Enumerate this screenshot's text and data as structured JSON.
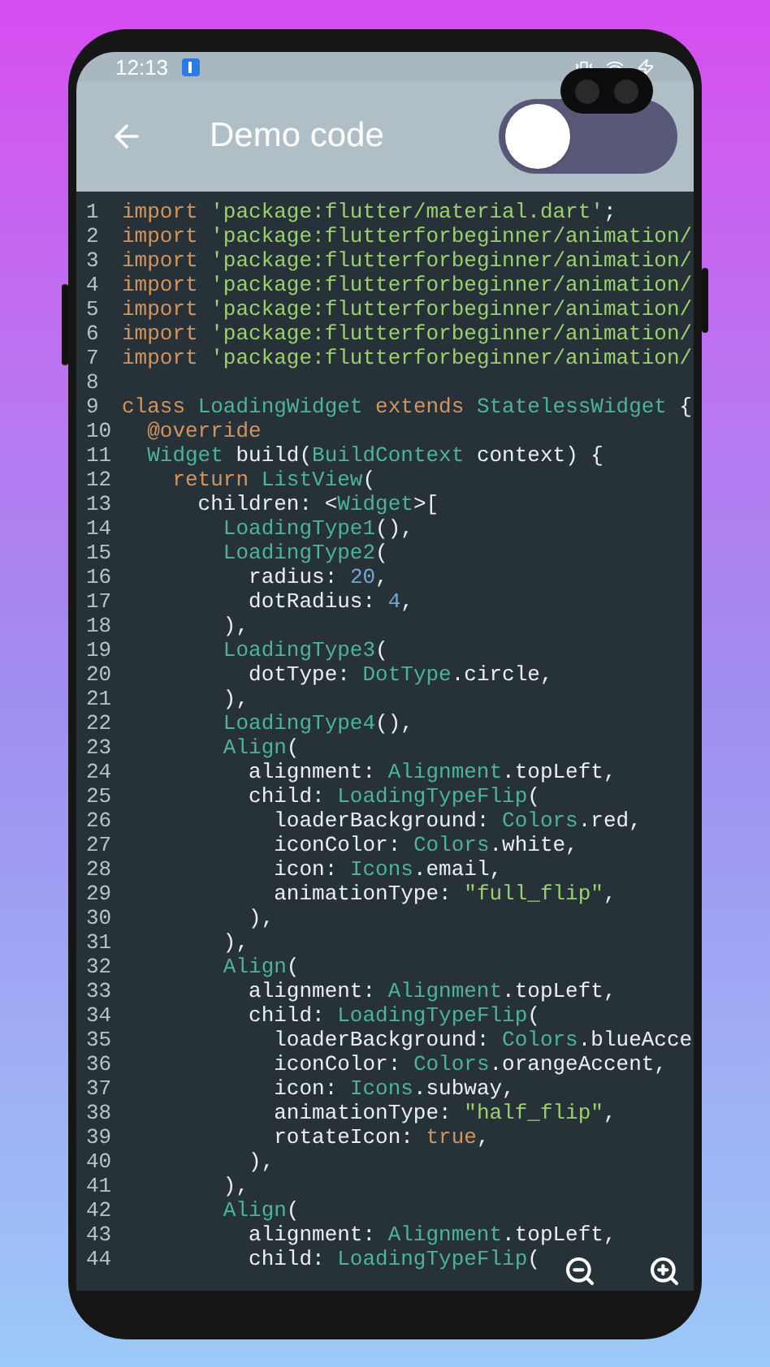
{
  "status_bar": {
    "time": "12:13"
  },
  "app_bar": {
    "title": "Demo code",
    "theme_switch": {
      "on": false
    }
  },
  "code": {
    "lines": [
      {
        "number": "1",
        "tokens": [
          {
            "kind": "keyword",
            "text": "import"
          },
          {
            "kind": "string",
            "text": " 'package:flutter/material.dart'"
          },
          {
            "kind": "plain",
            "text": ";"
          }
        ]
      },
      {
        "number": "2",
        "tokens": [
          {
            "kind": "keyword",
            "text": "import"
          },
          {
            "kind": "string",
            "text": " 'package:flutterforbeginner/animation/"
          }
        ]
      },
      {
        "number": "3",
        "tokens": [
          {
            "kind": "keyword",
            "text": "import"
          },
          {
            "kind": "string",
            "text": " 'package:flutterforbeginner/animation/"
          }
        ]
      },
      {
        "number": "4",
        "tokens": [
          {
            "kind": "keyword",
            "text": "import"
          },
          {
            "kind": "string",
            "text": " 'package:flutterforbeginner/animation/"
          }
        ]
      },
      {
        "number": "5",
        "tokens": [
          {
            "kind": "keyword",
            "text": "import"
          },
          {
            "kind": "string",
            "text": " 'package:flutterforbeginner/animation/"
          }
        ]
      },
      {
        "number": "6",
        "tokens": [
          {
            "kind": "keyword",
            "text": "import"
          },
          {
            "kind": "string",
            "text": " 'package:flutterforbeginner/animation/"
          }
        ]
      },
      {
        "number": "7",
        "tokens": [
          {
            "kind": "keyword",
            "text": "import"
          },
          {
            "kind": "string",
            "text": " 'package:flutterforbeginner/animation/"
          }
        ]
      },
      {
        "number": "8"
      },
      {
        "number": "9",
        "tokens": [
          {
            "kind": "keyword",
            "text": "class"
          },
          {
            "kind": "type",
            "text": " LoadingWidget"
          },
          {
            "kind": "keyword",
            "text": " extends"
          },
          {
            "kind": "type",
            "text": " StatelessWidget"
          },
          {
            "kind": "plain",
            "text": " {"
          }
        ]
      },
      {
        "number": "10",
        "tokens": [
          {
            "kind": "keyword",
            "text": "  @override"
          }
        ]
      },
      {
        "number": "11",
        "tokens": [
          {
            "kind": "type",
            "text": "  Widget"
          },
          {
            "kind": "plain",
            "text": " build("
          },
          {
            "kind": "type",
            "text": "BuildContext"
          },
          {
            "kind": "plain",
            "text": " context) {"
          }
        ]
      },
      {
        "number": "12",
        "tokens": [
          {
            "kind": "keyword",
            "text": "    return"
          },
          {
            "kind": "type",
            "text": " ListView"
          },
          {
            "kind": "plain",
            "text": "("
          }
        ]
      },
      {
        "number": "13",
        "tokens": [
          {
            "kind": "plain",
            "text": "      children: <"
          },
          {
            "kind": "type",
            "text": "Widget"
          },
          {
            "kind": "plain",
            "text": ">["
          }
        ]
      },
      {
        "number": "14",
        "tokens": [
          {
            "kind": "type",
            "text": "        LoadingType1"
          },
          {
            "kind": "plain",
            "text": "(),"
          }
        ]
      },
      {
        "number": "15",
        "tokens": [
          {
            "kind": "type",
            "text": "        LoadingType2"
          },
          {
            "kind": "plain",
            "text": "("
          }
        ]
      },
      {
        "number": "16",
        "tokens": [
          {
            "kind": "plain",
            "text": "          radius: "
          },
          {
            "kind": "number",
            "text": "20"
          },
          {
            "kind": "plain",
            "text": ","
          }
        ]
      },
      {
        "number": "17",
        "tokens": [
          {
            "kind": "plain",
            "text": "          dotRadius: "
          },
          {
            "kind": "number",
            "text": "4"
          },
          {
            "kind": "plain",
            "text": ","
          }
        ]
      },
      {
        "number": "18",
        "tokens": [
          {
            "kind": "plain",
            "text": "        ),"
          }
        ]
      },
      {
        "number": "19",
        "tokens": [
          {
            "kind": "type",
            "text": "        LoadingType3"
          },
          {
            "kind": "plain",
            "text": "("
          }
        ]
      },
      {
        "number": "20",
        "tokens": [
          {
            "kind": "plain",
            "text": "          dotType: "
          },
          {
            "kind": "type",
            "text": "DotType"
          },
          {
            "kind": "plain",
            "text": ".circle,"
          }
        ]
      },
      {
        "number": "21",
        "tokens": [
          {
            "kind": "plain",
            "text": "        ),"
          }
        ]
      },
      {
        "number": "22",
        "tokens": [
          {
            "kind": "type",
            "text": "        LoadingType4"
          },
          {
            "kind": "plain",
            "text": "(),"
          }
        ]
      },
      {
        "number": "23",
        "tokens": [
          {
            "kind": "type",
            "text": "        Align"
          },
          {
            "kind": "plain",
            "text": "("
          }
        ]
      },
      {
        "number": "24",
        "tokens": [
          {
            "kind": "plain",
            "text": "          alignment: "
          },
          {
            "kind": "type",
            "text": "Alignment"
          },
          {
            "kind": "plain",
            "text": ".topLeft,"
          }
        ]
      },
      {
        "number": "25",
        "tokens": [
          {
            "kind": "plain",
            "text": "          child: "
          },
          {
            "kind": "type",
            "text": "LoadingTypeFlip"
          },
          {
            "kind": "plain",
            "text": "("
          }
        ]
      },
      {
        "number": "26",
        "tokens": [
          {
            "kind": "plain",
            "text": "            loaderBackground: "
          },
          {
            "kind": "type",
            "text": "Colors"
          },
          {
            "kind": "plain",
            "text": ".red,"
          }
        ]
      },
      {
        "number": "27",
        "tokens": [
          {
            "kind": "plain",
            "text": "            iconColor: "
          },
          {
            "kind": "type",
            "text": "Colors"
          },
          {
            "kind": "plain",
            "text": ".white,"
          }
        ]
      },
      {
        "number": "28",
        "tokens": [
          {
            "kind": "plain",
            "text": "            icon: "
          },
          {
            "kind": "type",
            "text": "Icons"
          },
          {
            "kind": "plain",
            "text": ".email,"
          }
        ]
      },
      {
        "number": "29",
        "tokens": [
          {
            "kind": "plain",
            "text": "            animationType: "
          },
          {
            "kind": "string",
            "text": "\"full_flip\""
          },
          {
            "kind": "plain",
            "text": ","
          }
        ]
      },
      {
        "number": "30",
        "tokens": [
          {
            "kind": "plain",
            "text": "          ),"
          }
        ]
      },
      {
        "number": "31",
        "tokens": [
          {
            "kind": "plain",
            "text": "        ),"
          }
        ]
      },
      {
        "number": "32",
        "tokens": [
          {
            "kind": "type",
            "text": "        Align"
          },
          {
            "kind": "plain",
            "text": "("
          }
        ]
      },
      {
        "number": "33",
        "tokens": [
          {
            "kind": "plain",
            "text": "          alignment: "
          },
          {
            "kind": "type",
            "text": "Alignment"
          },
          {
            "kind": "plain",
            "text": ".topLeft,"
          }
        ]
      },
      {
        "number": "34",
        "tokens": [
          {
            "kind": "plain",
            "text": "          child: "
          },
          {
            "kind": "type",
            "text": "LoadingTypeFlip"
          },
          {
            "kind": "plain",
            "text": "("
          }
        ]
      },
      {
        "number": "35",
        "tokens": [
          {
            "kind": "plain",
            "text": "            loaderBackground: "
          },
          {
            "kind": "type",
            "text": "Colors"
          },
          {
            "kind": "plain",
            "text": ".blueAcce"
          }
        ]
      },
      {
        "number": "36",
        "tokens": [
          {
            "kind": "plain",
            "text": "            iconColor: "
          },
          {
            "kind": "type",
            "text": "Colors"
          },
          {
            "kind": "plain",
            "text": ".orangeAccent,"
          }
        ]
      },
      {
        "number": "37",
        "tokens": [
          {
            "kind": "plain",
            "text": "            icon: "
          },
          {
            "kind": "type",
            "text": "Icons"
          },
          {
            "kind": "plain",
            "text": ".subway,"
          }
        ]
      },
      {
        "number": "38",
        "tokens": [
          {
            "kind": "plain",
            "text": "            animationType: "
          },
          {
            "kind": "string",
            "text": "\"half_flip\""
          },
          {
            "kind": "plain",
            "text": ","
          }
        ]
      },
      {
        "number": "39",
        "tokens": [
          {
            "kind": "plain",
            "text": "            rotateIcon: "
          },
          {
            "kind": "keyword",
            "text": "true"
          },
          {
            "kind": "plain",
            "text": ","
          }
        ]
      },
      {
        "number": "40",
        "tokens": [
          {
            "kind": "plain",
            "text": "          ),"
          }
        ]
      },
      {
        "number": "41",
        "tokens": [
          {
            "kind": "plain",
            "text": "        ),"
          }
        ]
      },
      {
        "number": "42",
        "tokens": [
          {
            "kind": "type",
            "text": "        Align"
          },
          {
            "kind": "plain",
            "text": "("
          }
        ]
      },
      {
        "number": "43",
        "tokens": [
          {
            "kind": "plain",
            "text": "          alignment: "
          },
          {
            "kind": "type",
            "text": "Alignment"
          },
          {
            "kind": "plain",
            "text": ".topLeft,"
          }
        ]
      },
      {
        "number": "44",
        "tokens": [
          {
            "kind": "plain",
            "text": "          child: "
          },
          {
            "kind": "type",
            "text": "LoadingTypeFlip"
          },
          {
            "kind": "plain",
            "text": "("
          }
        ]
      }
    ]
  }
}
